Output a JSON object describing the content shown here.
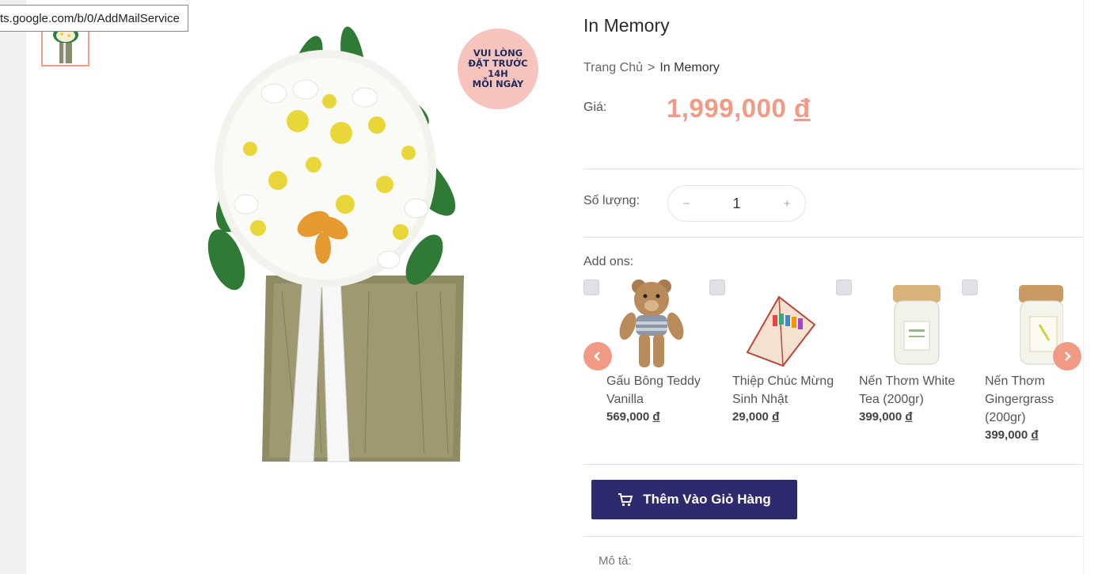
{
  "status_tip": "ts.google.com/b/0/AddMailService",
  "badge": {
    "line1": "VUI LÒNG",
    "line2": "ĐẶT TRƯỚC",
    "line3": "14H",
    "line4": "MỖI NGÀY"
  },
  "product": {
    "title": "In Memory",
    "price_label": "Giá:",
    "price_value": "1,999,000",
    "currency": "đ"
  },
  "breadcrumb": {
    "home": "Trang Chủ",
    "separator": ">",
    "current": "In Memory"
  },
  "quantity": {
    "label": "Số lượng:",
    "minus": "−",
    "value": "1",
    "plus": "+"
  },
  "addons": {
    "label": "Add ons:",
    "items": [
      {
        "name": "Gấu Bông Teddy Vanilla",
        "price": "569,000",
        "currency": "đ",
        "icon": "teddy-bear"
      },
      {
        "name": "Thiệp Chúc Mừng Sinh Nhật",
        "price": "29,000",
        "currency": "đ",
        "icon": "greeting-card"
      },
      {
        "name": "Nến Thơm White Tea (200gr)",
        "price": "399,000",
        "currency": "đ",
        "icon": "candle-jar"
      },
      {
        "name": "Nến Thơm Gingergrass (200gr)",
        "price": "399,000",
        "currency": "đ",
        "icon": "candle-jar"
      }
    ]
  },
  "cart_button": {
    "label": "Thêm Vào Giỏ Hàng",
    "icon": "cart-icon"
  },
  "description_label": "Mô tả:",
  "colors": {
    "accent": "#f19a85",
    "button": "#2d2a6e",
    "badge": "#f7c4bd"
  }
}
